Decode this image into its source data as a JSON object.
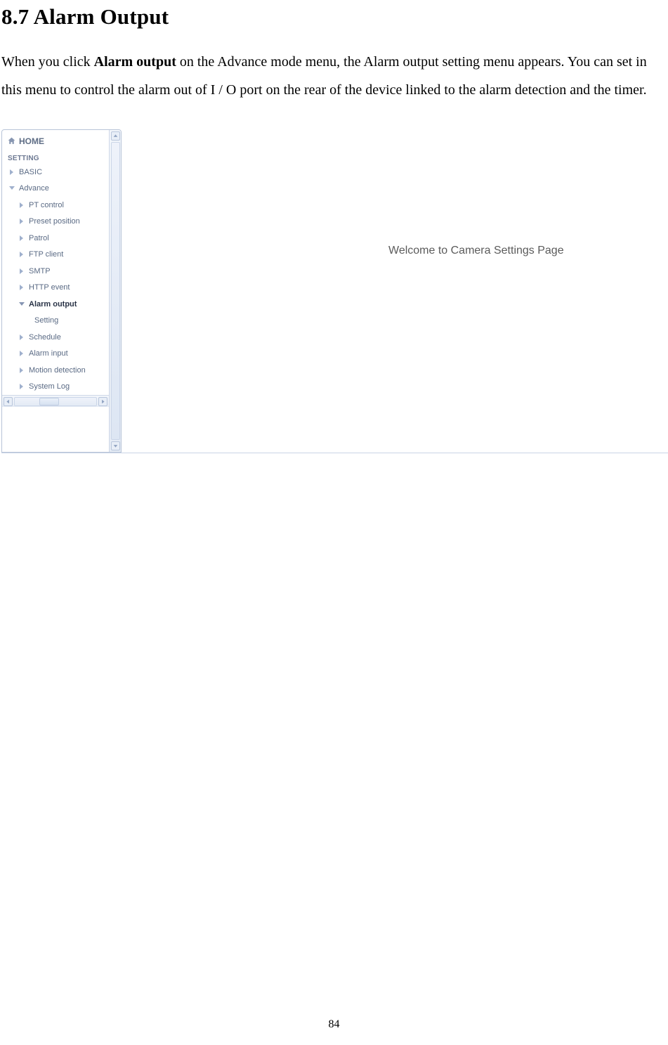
{
  "section": {
    "number": "8.7",
    "title": "Alarm Output",
    "full_title": "8.7 Alarm Output"
  },
  "body": {
    "pre_bold": "When you click ",
    "bold": "Alarm output",
    "post_bold": " on the Advance mode menu, the Alarm output setting menu appears. You can set in this menu to control the alarm out of I / O port on the rear of the device linked to the alarm detection and the timer."
  },
  "screenshot": {
    "sidebar": {
      "home_label": "HOME",
      "setting_header": "SETTING",
      "basic_label": "BASIC",
      "advance_label": "Advance",
      "items": [
        {
          "label": "PT control"
        },
        {
          "label": "Preset position"
        },
        {
          "label": "Patrol"
        },
        {
          "label": "FTP client"
        },
        {
          "label": "SMTP"
        },
        {
          "label": "HTTP event"
        },
        {
          "label": "Alarm output",
          "bold": true,
          "expanded": true
        },
        {
          "label": "Setting",
          "child": true
        },
        {
          "label": "Schedule"
        },
        {
          "label": "Alarm input"
        },
        {
          "label": "Motion detection"
        },
        {
          "label": "System Log"
        }
      ]
    },
    "content": {
      "welcome": "Welcome to Camera Settings Page"
    }
  },
  "page_number": "84"
}
